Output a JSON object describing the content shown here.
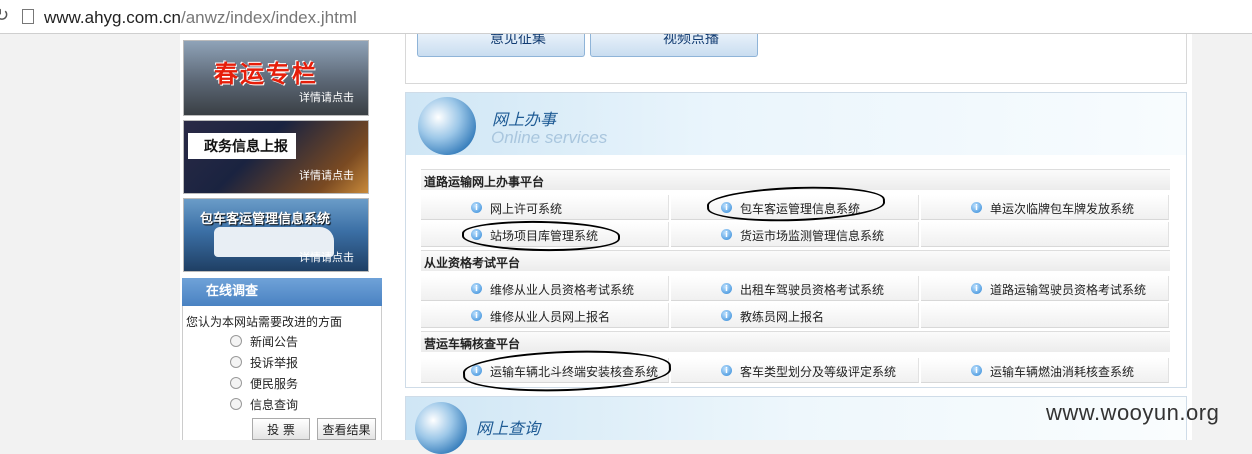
{
  "browser": {
    "url_host": "www.ahyg.com.cn",
    "url_path": "/anwz/index/index.jhtml"
  },
  "banners": [
    {
      "title": "春运专栏",
      "detail": "详情请点击"
    },
    {
      "title": "政务信息上报",
      "detail": "详情请点击"
    },
    {
      "title": "包车客运管理信息系统",
      "detail": "详情请点击"
    }
  ],
  "survey": {
    "title": "在线调查",
    "question": "您认为本网站需要改进的方面",
    "options": [
      "新闻公告",
      "投诉举报",
      "便民服务",
      "信息查询"
    ],
    "vote_label": "投 票",
    "results_label": "查看结果"
  },
  "top_buttons": [
    "意见征集",
    "视频点播"
  ],
  "online_services": {
    "title": "网上办事",
    "subtitle": "Online services",
    "sections": [
      {
        "title": "道路运输网上办事平台",
        "rows": [
          [
            "网上许可系统",
            "包车客运管理信息系统",
            "单运次临牌包车牌发放系统"
          ],
          [
            "站场项目库管理系统",
            "货运市场监测管理信息系统",
            ""
          ]
        ]
      },
      {
        "title": "从业资格考试平台",
        "rows": [
          [
            "维修从业人员资格考试系统",
            "出租车驾驶员资格考试系统",
            "道路运输驾驶员资格考试系统"
          ],
          [
            "维修从业人员网上报名",
            "教练员网上报名",
            ""
          ]
        ]
      },
      {
        "title": "营运车辆核查平台",
        "rows": [
          [
            "运输车辆北斗终端安装核查系统",
            "客车类型划分及等级评定系统",
            "运输车辆燃油消耗核查系统"
          ]
        ]
      }
    ]
  },
  "online_query": {
    "title": "网上查询"
  },
  "watermark": "www.wooyun.org"
}
